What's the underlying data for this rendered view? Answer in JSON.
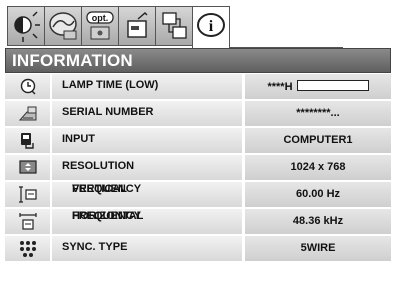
{
  "tabs": [
    {
      "icon": "brightness-icon",
      "active": false
    },
    {
      "icon": "image-adjust-icon",
      "active": false
    },
    {
      "icon": "option-icon",
      "label": "opt.",
      "active": false
    },
    {
      "icon": "setting-icon",
      "active": false
    },
    {
      "icon": "network-icon",
      "active": false
    },
    {
      "icon": "info-icon",
      "label": "i",
      "active": true
    }
  ],
  "header": {
    "title": "INFORMATION"
  },
  "rows": [
    {
      "icon": "lamp-time-icon",
      "label": "LAMP TIME (LOW)",
      "value": "****H",
      "bar": true
    },
    {
      "icon": "serial-number-icon",
      "label": "SERIAL NUMBER",
      "value": "********..."
    },
    {
      "icon": "input-icon",
      "label": "INPUT",
      "value": "COMPUTER1"
    },
    {
      "icon": "resolution-icon",
      "label": "RESOLUTION",
      "value": "1024 x 768"
    },
    {
      "icon": "vertical-frequency-icon",
      "label_lines": [
        "VERTICAL",
        "FREQUENCY"
      ],
      "value": "60.00 Hz"
    },
    {
      "icon": "horizontal-frequency-icon",
      "label_lines": [
        "HORIZONTAL",
        "FREQUENCY"
      ],
      "value": "48.36 kHz"
    },
    {
      "icon": "sync-type-icon",
      "label": "SYNC. TYPE",
      "value": "5WIRE"
    }
  ]
}
